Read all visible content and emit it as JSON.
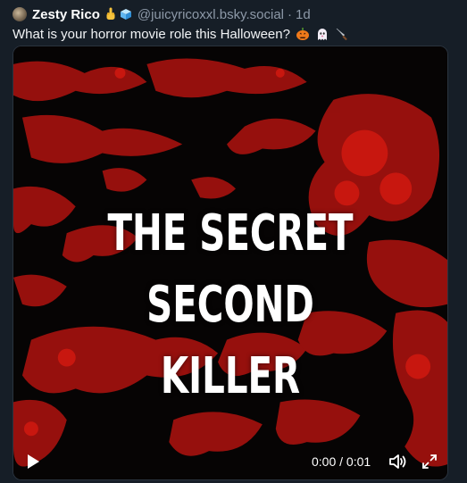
{
  "post": {
    "author": {
      "display_name": "Zesty Rico",
      "display_name_emojis": [
        "middle-finger-icon",
        "ice-cube-icon"
      ],
      "handle": "@juicyricoxxl.bsky.social",
      "separator": "·",
      "time_ago": "1d"
    },
    "text": "What is your horror movie role this Halloween?",
    "text_emojis": [
      "jack-o-lantern-icon",
      "ghost-icon",
      "knife-icon"
    ],
    "video": {
      "title_line_1": "THE SECRET",
      "title_line_2": "SECOND KILLER",
      "time_readout": "0:00 / 0:01",
      "accent_color": "#b3120f"
    }
  },
  "colors": {
    "background": "#161e27",
    "muted_text": "#8d99a8"
  }
}
